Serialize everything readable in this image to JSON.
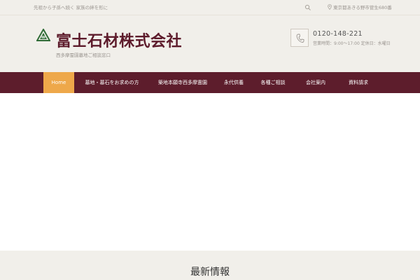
{
  "topbar": {
    "tagline": "先祖から子孫へ続く 家族の絆を形に",
    "address": "東京都あきる野市菅生680番"
  },
  "header": {
    "company_name": "富士石材株式会社",
    "subtitle": "西多摩霊園墓地ご相談窓口",
    "phone": "0120-148-221",
    "hours": "営業時間：9:00～17:00 定休日：水曜日"
  },
  "nav": {
    "items": [
      {
        "label": "Home"
      },
      {
        "label": "墓地・墓石をお求めの方"
      },
      {
        "label": "築地本願寺西多摩霊園"
      },
      {
        "label": "永代供養"
      },
      {
        "label": "各種ご相談"
      },
      {
        "label": "会社案内"
      },
      {
        "label": "資料請求"
      }
    ]
  },
  "news": {
    "heading": "最新情報"
  },
  "colors": {
    "brand": "#5d1d2c",
    "accent": "#eea84a",
    "logo_green": "#2f6b36"
  },
  "icons": [
    "search-icon",
    "map-pin-icon",
    "phone-icon",
    "logo-mark-icon"
  ]
}
